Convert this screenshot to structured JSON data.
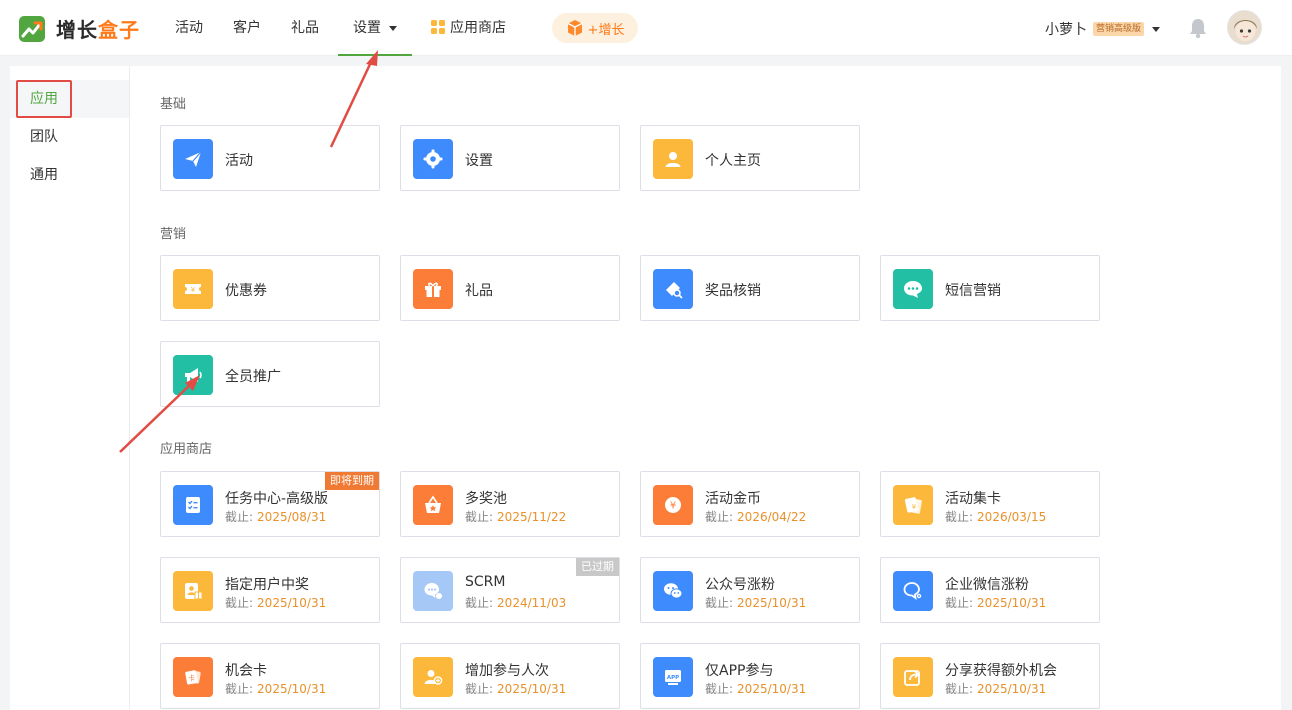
{
  "app": {
    "logo_part1": "增长",
    "logo_part2": "盒子"
  },
  "nav": {
    "items": [
      "活动",
      "客户",
      "礼品",
      "设置"
    ],
    "store": "应用商店",
    "grow": "+增长"
  },
  "user": {
    "name": "小萝卜",
    "tag": "营销高级版"
  },
  "sidebar": {
    "items": [
      "应用",
      "团队",
      "通用"
    ]
  },
  "sections": {
    "basic": "基础",
    "marketing": "营销",
    "store": "应用商店"
  },
  "basic_cards": [
    "活动",
    "设置",
    "个人主页"
  ],
  "marketing_cards": [
    "优惠券",
    "礼品",
    "奖品核销",
    "短信营销",
    "全员推广"
  ],
  "store_cards": [
    {
      "name": "任务中心-高级版",
      "exp_label": "截止:",
      "date": "2025/08/31",
      "badge": "即将到期"
    },
    {
      "name": "多奖池",
      "exp_label": "截止:",
      "date": "2025/11/22"
    },
    {
      "name": "活动金币",
      "exp_label": "截止:",
      "date": "2026/04/22"
    },
    {
      "name": "活动集卡",
      "exp_label": "截止:",
      "date": "2026/03/15"
    },
    {
      "name": "指定用户中奖",
      "exp_label": "截止:",
      "date": "2025/10/31"
    },
    {
      "name": "SCRM",
      "exp_label": "截止:",
      "date": "2024/11/03",
      "badge": "已过期"
    },
    {
      "name": "公众号涨粉",
      "exp_label": "截止:",
      "date": "2025/10/31"
    },
    {
      "name": "企业微信涨粉",
      "exp_label": "截止:",
      "date": "2025/10/31"
    },
    {
      "name": "机会卡",
      "exp_label": "截止:",
      "date": "2025/10/31"
    },
    {
      "name": "增加参与人次",
      "exp_label": "截止:",
      "date": "2025/10/31"
    },
    {
      "name": "仅APP参与",
      "exp_label": "截止:",
      "date": "2025/10/31"
    },
    {
      "name": "分享获得额外机会",
      "exp_label": "截止:",
      "date": "2025/10/31"
    }
  ],
  "colors": {
    "accent": "#52a640",
    "brand_orange": "#ff7a1a",
    "annotation_red": "#e14c44"
  }
}
